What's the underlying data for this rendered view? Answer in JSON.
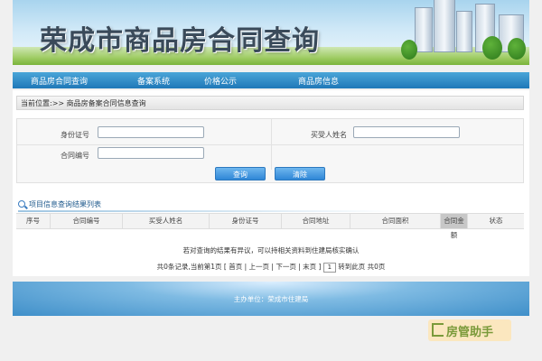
{
  "header": {
    "title": "荣成市商品房合同查询"
  },
  "nav": {
    "items": [
      {
        "label": "商品房合同查询"
      },
      {
        "label": "备案系统"
      },
      {
        "label": "价格公示"
      },
      {
        "label": "商品房信息"
      }
    ]
  },
  "breadcrumb": {
    "text": "当前位置:>> 商品房备案合同信息查询"
  },
  "form": {
    "id_label": "身份证号",
    "buyer_label": "买受人姓名",
    "contract_label": "合同编号",
    "id_value": "",
    "buyer_value": "",
    "contract_value": ""
  },
  "buttons": {
    "query": "查询",
    "clear": "清除"
  },
  "results": {
    "title": "项目信息查询结果列表",
    "columns": [
      "序号",
      "合同编号",
      "买受人姓名",
      "身份证号",
      "合同地址",
      "合同面积",
      "合同金额",
      "状态"
    ]
  },
  "notice": "若对查询的结果有异议，可以持相关资料到住建局核实确认",
  "pager": {
    "summary": "共0条记录,当前第1页",
    "first": "首页",
    "prev": "上一页",
    "next": "下一页",
    "last": "末页",
    "page_input": "1",
    "goto": "转到此页",
    "total_pages": "共0页"
  },
  "footer": {
    "text": "主办单位：荣成市住建局"
  },
  "watermark": {
    "text": "房管助手",
    "icon": "house-icon"
  }
}
